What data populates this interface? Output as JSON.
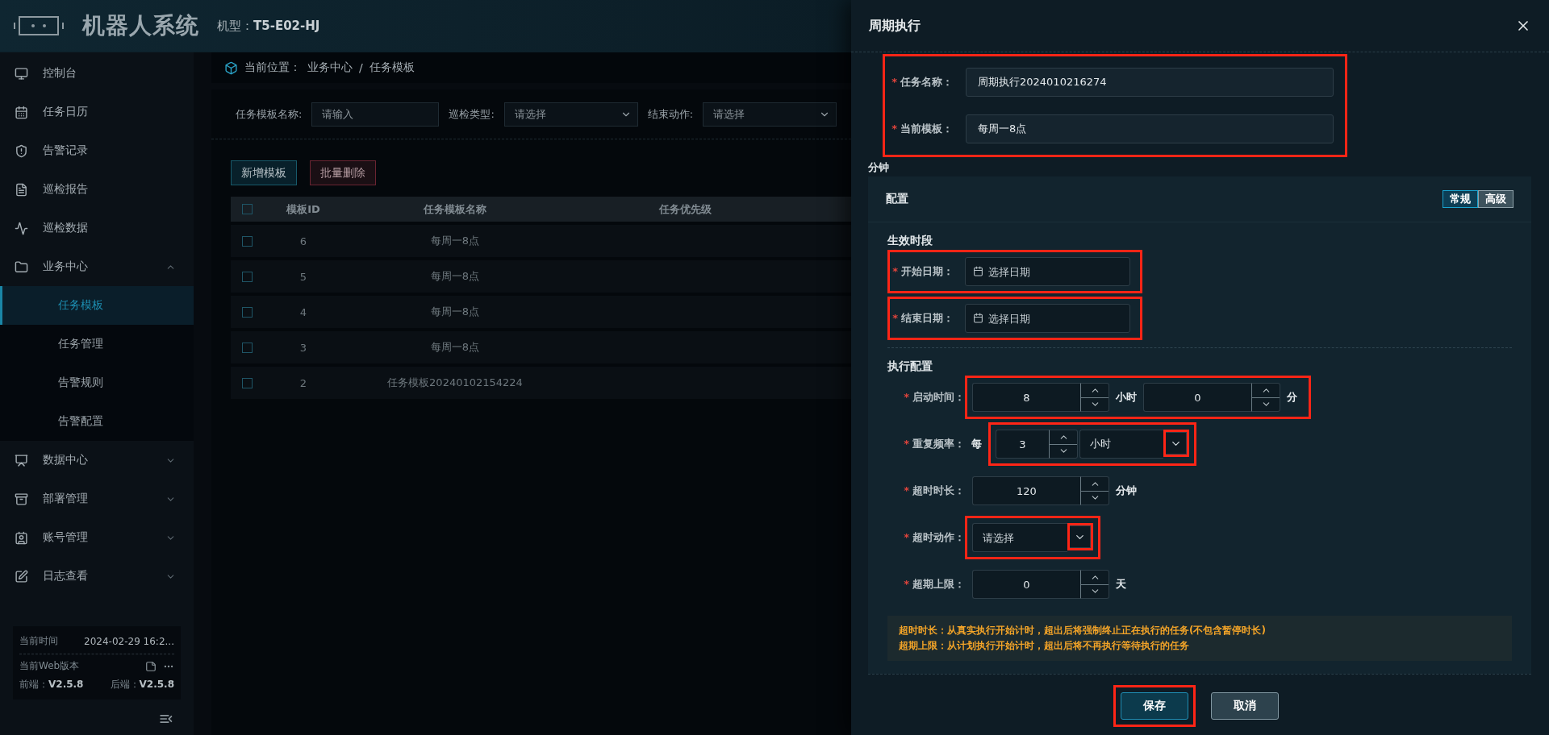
{
  "header": {
    "title": "机器人系统",
    "model": "机型：**T5-E02-HJ**"
  },
  "sidebar": {
    "items": [
      {
        "kind": "link",
        "label": "控制台",
        "selected": false
      },
      {
        "kind": "link",
        "label": "任务日历",
        "selected": false
      },
      {
        "kind": "link",
        "label": "告警记录",
        "selected": false
      },
      {
        "kind": "link",
        "label": "巡检报告",
        "selected": false
      },
      {
        "kind": "link",
        "label": "巡检数据",
        "selected": false
      },
      {
        "kind": "group",
        "label": "业务中心",
        "selected": false,
        "expanded": true,
        "children": [
          {
            "label": "任务模板",
            "selected": true
          },
          {
            "label": "任务管理",
            "selected": false
          },
          {
            "label": "告警规则",
            "selected": false
          },
          {
            "label": "告警配置",
            "selected": false
          }
        ]
      },
      {
        "kind": "group",
        "label": "数据中心",
        "selected": false,
        "expanded": false
      },
      {
        "kind": "group",
        "label": "部署管理",
        "selected": false,
        "expanded": false
      },
      {
        "kind": "group",
        "label": "账号管理",
        "selected": false,
        "expanded": false
      },
      {
        "kind": "group",
        "label": "日志查看",
        "selected": false,
        "expanded": false
      }
    ],
    "footer": {
      "time_label": "当前时间",
      "time_value": "2024-02-29 16:2...",
      "version_label": "当前Web版本",
      "frontend": "前端：**V2.5.8**",
      "backend": "后端：**V2.5.8**"
    }
  },
  "breadcrumb": {
    "label": "当前位置：",
    "separator": "/",
    "path": [
      "业务中心",
      "任务模板"
    ]
  },
  "filters": [
    {
      "kind": "input",
      "label": "任务模板名称:",
      "placeholder": "请输入"
    },
    {
      "kind": "select",
      "label": "巡检类型:",
      "placeholder": "请选择"
    },
    {
      "kind": "select",
      "label": "结束动作:",
      "placeholder": "请选择"
    }
  ],
  "toolbar": [
    {
      "kind": "primary",
      "label": "新增模板"
    },
    {
      "kind": "danger",
      "label": "批量删除"
    }
  ],
  "table": {
    "all_checked": false,
    "columns": [
      "模板ID",
      "任务模板名称",
      "任务优先级"
    ],
    "rows": [
      {
        "checked": false,
        "cells": [
          "6",
          "每周一8点"
        ]
      },
      {
        "checked": false,
        "cells": [
          "5",
          "每周一8点"
        ]
      },
      {
        "checked": false,
        "cells": [
          "4",
          "每周一8点"
        ]
      },
      {
        "checked": false,
        "cells": [
          "3",
          "每周一8点"
        ]
      },
      {
        "checked": false,
        "cells": [
          "2",
          "任务模板20240102154224"
        ]
      }
    ]
  },
  "drawer": {
    "title": "周期执行",
    "basic_highlighted": true,
    "basic_fields": [
      {
        "label": "任务名称：",
        "required_mark": "*",
        "value": "周期执行2024010216274"
      },
      {
        "label": "当前模板：",
        "required_mark": "*",
        "value": "每周一8点"
      }
    ],
    "loose_text": "分钟",
    "config": {
      "title": "配置",
      "modes": [
        {
          "label": "常规",
          "selected": true
        },
        {
          "label": "高级",
          "selected": false
        }
      ],
      "period": {
        "title": "生效时段",
        "fields": [
          {
            "label": "开始日期：",
            "required_mark": "*",
            "highlighted": true,
            "placeholder": "选择日期"
          },
          {
            "label": "结束日期：",
            "required_mark": "*",
            "highlighted": true,
            "placeholder": "选择日期"
          }
        ]
      },
      "exec": {
        "title": "执行配置",
        "rows": [
          {
            "kind": "time",
            "label": "启动时间：",
            "required_mark": "*",
            "highlighted": true,
            "inputs": [
              {
                "value": "8",
                "unit": "小时"
              },
              {
                "value": "0",
                "unit": "分"
              }
            ]
          },
          {
            "kind": "repeat",
            "label": "重复频率：",
            "required_mark": "*",
            "highlighted": true,
            "prefix": "每",
            "value": "3",
            "unit_value": "小时",
            "chevron_highlighted": true
          },
          {
            "kind": "number",
            "label": "超时时长：",
            "required_mark": "*",
            "highlighted": false,
            "value": "120",
            "unit": "分钟"
          },
          {
            "kind": "select",
            "label": "超时动作：",
            "required_mark": "*",
            "highlighted": true,
            "placeholder": "请选择",
            "chevron_highlighted": true
          },
          {
            "kind": "number",
            "label": "超期上限：",
            "required_mark": "*",
            "highlighted": false,
            "value": "0",
            "unit": "天"
          }
        ]
      },
      "notes": [
        "超时时长：从真实执行开始计时，超出后将强制终止正在执行的任务(不包含暂停时长)",
        "超期上限：从计划执行开始计时，超出后将不再执行等待执行的任务"
      ]
    },
    "buttons": [
      {
        "kind": "primary",
        "label": "保存",
        "highlighted": true
      },
      {
        "kind": "default",
        "label": "取消",
        "highlighted": false
      }
    ]
  }
}
